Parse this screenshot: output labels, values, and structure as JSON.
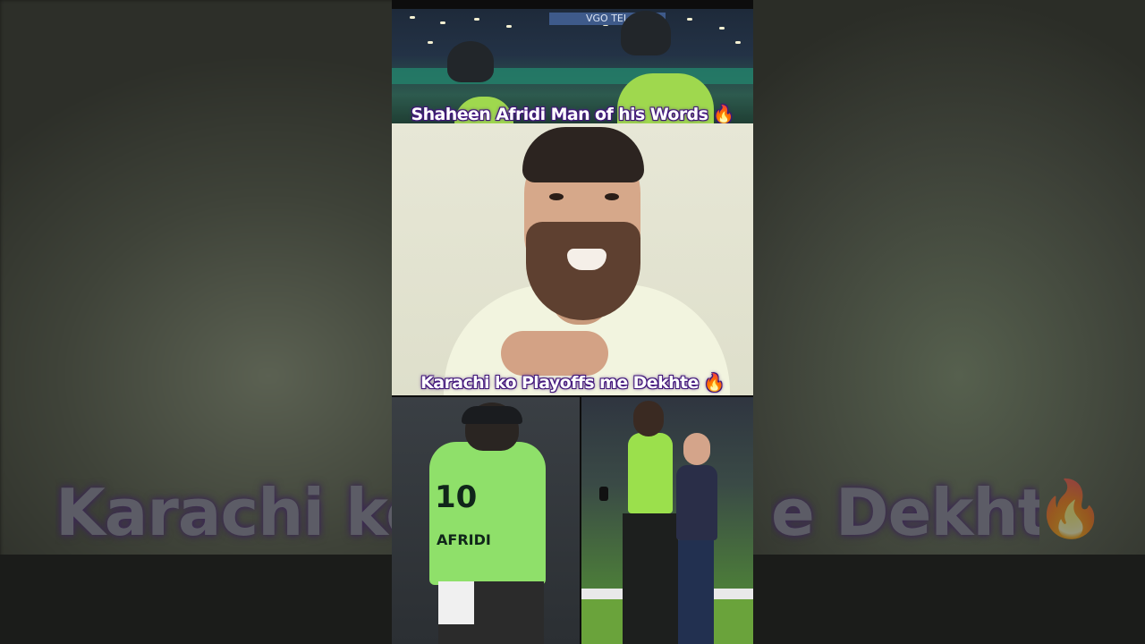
{
  "video": {
    "caption_top": "Shaheen Afridi Man of his Words",
    "caption_mid": "Karachi ko Playoffs me Dekhte",
    "caption_emoji": "🔥",
    "background_caption_left": "Karachi ko",
    "background_caption_right": "e Dekhte",
    "jersey_number": "10",
    "jersey_name": "AFRIDI",
    "ad_text": "VGO TEL"
  }
}
